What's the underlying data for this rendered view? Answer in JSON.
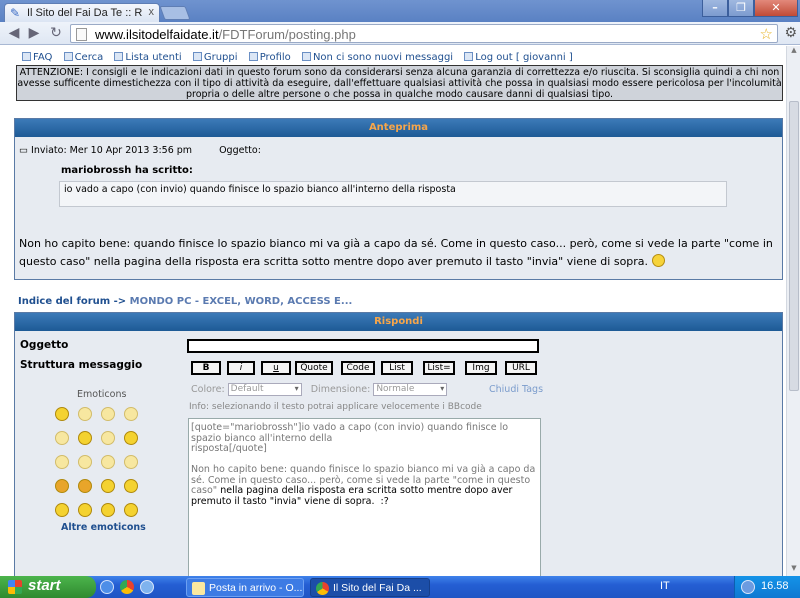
{
  "browser": {
    "tab_title": "Il Sito del Fai Da Te :: R",
    "url_host": "www.ilsitodelfaidate.it",
    "url_path": "/FDTForum/posting.php",
    "minimize_label": "–",
    "maximize_label": "❐",
    "close_label": "✕",
    "tab_close_label": "x"
  },
  "topnav": {
    "items": [
      "FAQ",
      "Cerca",
      "Lista utenti",
      "Gruppi",
      "Profilo",
      "Non ci sono nuovi messaggi",
      "Log out [ giovanni ]"
    ]
  },
  "warning": {
    "text": "ATTENZIONE: I consigli e le indicazioni dati in questo forum sono da considerarsi senza alcuna garanzia di correttezza e/o riuscita. Si sconsiglia quindi a chi non avesse sufficente dimestichezza con il tipo di attività da eseguire, dall'effettuare qualsiasi attività che possa in qualsiasi modo essere pericolosa per l'incolumità propria o delle altre persone o che possa in qualche modo causare danni di qualsiasi tipo."
  },
  "preview": {
    "header": "Anteprima",
    "posted": "Inviato: Mer 10 Apr 2013 3:56 pm",
    "subject_label": "Oggetto:",
    "quote_author": "mariobrossh ha scritto:",
    "quote_text": "io vado a capo (con invio) quando finisce lo spazio bianco all'interno della risposta",
    "body": "Non ho capito bene: quando finisce lo spazio bianco mi va già a capo da sé. Come in questo caso... però, come si vede la parte \"come in questo caso\" nella pagina della risposta era scritta sotto mentre dopo aver premuto il tasto \"invia\" viene di sopra."
  },
  "breadcrumb": {
    "index": "Indice del forum",
    "separator": "->",
    "category": "MONDO PC - EXCEL, WORD, ACCESS E..."
  },
  "reply": {
    "header": "Rispondi",
    "subject_label": "Oggetto",
    "structure_label": "Struttura messaggio",
    "buttons": [
      "B",
      "i",
      "u",
      "Quote",
      "Code",
      "List",
      "List=",
      "Img",
      "URL"
    ],
    "color_label": "Colore:",
    "color_value": "Default",
    "size_label": "Dimensione:",
    "size_value": "Normale",
    "close_tags": "Chiudi Tags",
    "info": "Info: selezionando il testo potrai applicare velocemente i BBcode",
    "emoticons_title": "Emoticons",
    "more_emoticons": "Altre emoticons",
    "message_light": "[quote=\"mariobrossh\"]io vado a capo (con invio) quando finisce lo spazio bianco all'interno della\nrisposta[/quote]\n\nNon ho capito bene: quando finisce lo spazio bianco mi va già a capo da sé. Come in questo caso... però, come si vede la parte \"come in questo caso\" ",
    "message_dark": "nella pagina della risposta era scritta sotto mentre dopo aver premuto il tasto \"invia\" viene di sopra.  :?"
  },
  "taskbar": {
    "start": "start",
    "task1": "Posta in arrivo - O...",
    "task2": "Il Sito del Fai Da ...",
    "lang": "IT",
    "clock": "16.58"
  }
}
